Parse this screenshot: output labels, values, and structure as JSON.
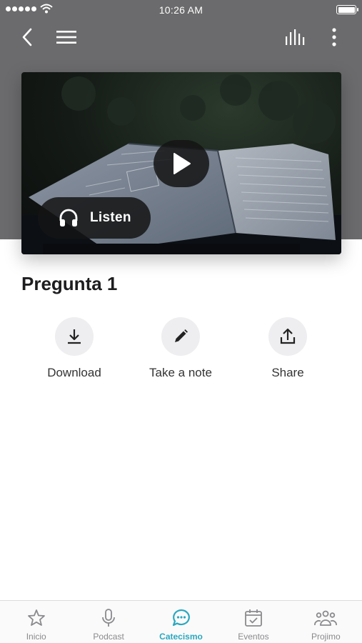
{
  "status_bar": {
    "time": "10:26 AM"
  },
  "nav": {
    "back_icon": "chevron-left-icon",
    "menu_icon": "hamburger-menu-icon",
    "equalizer_icon": "equalizer-icon",
    "more_icon": "more-vertical-icon"
  },
  "hero": {
    "image_description_icon": "open-book-image",
    "play_icon": "play-icon",
    "listen_label": "Listen",
    "listen_icon": "headphones-icon"
  },
  "content": {
    "title": "Pregunta 1"
  },
  "actions": [
    {
      "label": "Download",
      "icon": "download-icon"
    },
    {
      "label": "Take a note",
      "icon": "pencil-icon"
    },
    {
      "label": "Share",
      "icon": "share-icon"
    }
  ],
  "tabbar": {
    "active_color": "#2aa8c0",
    "inactive_color": "#8a8a8e",
    "tabs": [
      {
        "label": "Inicio",
        "icon": "star-icon"
      },
      {
        "label": "Podcast",
        "icon": "microphone-icon"
      },
      {
        "label": "Catecismo",
        "icon": "chat-bubble-icon",
        "active": true
      },
      {
        "label": "Eventos",
        "icon": "calendar-check-icon"
      },
      {
        "label": "Projimo",
        "icon": "people-icon"
      }
    ]
  }
}
